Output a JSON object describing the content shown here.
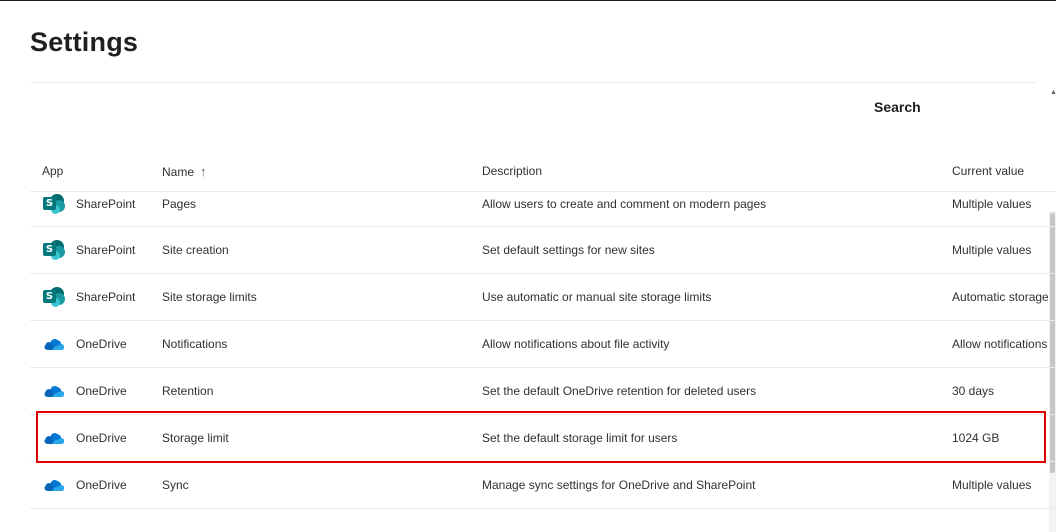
{
  "page": {
    "title": "Settings"
  },
  "search": {
    "label": "Search"
  },
  "table": {
    "columns": {
      "app": "App",
      "name": "Name",
      "name_sort": "↑",
      "description": "Description",
      "current_value": "Current value"
    },
    "rows": [
      {
        "icon": "sharepoint-icon",
        "app": "SharePoint",
        "name": "Pages",
        "description": "Allow users to create and comment on modern pages",
        "value": "Multiple values"
      },
      {
        "icon": "sharepoint-icon",
        "app": "SharePoint",
        "name": "Site creation",
        "description": "Set default settings for new sites",
        "value": "Multiple values"
      },
      {
        "icon": "sharepoint-icon",
        "app": "SharePoint",
        "name": "Site storage limits",
        "description": "Use automatic or manual site storage limits",
        "value": "Automatic storage"
      },
      {
        "icon": "onedrive-icon",
        "app": "OneDrive",
        "name": "Notifications",
        "description": "Allow notifications about file activity",
        "value": "Allow notifications"
      },
      {
        "icon": "onedrive-icon",
        "app": "OneDrive",
        "name": "Retention",
        "description": "Set the default OneDrive retention for deleted users",
        "value": "30 days"
      },
      {
        "icon": "onedrive-icon",
        "app": "OneDrive",
        "name": "Storage limit",
        "description": "Set the default storage limit for users",
        "value": "1024 GB"
      },
      {
        "icon": "onedrive-icon",
        "app": "OneDrive",
        "name": "Sync",
        "description": "Manage sync settings for OneDrive and SharePoint",
        "value": "Multiple values"
      }
    ]
  },
  "colors": {
    "highlight": "#e00000",
    "sharepoint": "#03787c",
    "onedrive": "#0364b8"
  }
}
